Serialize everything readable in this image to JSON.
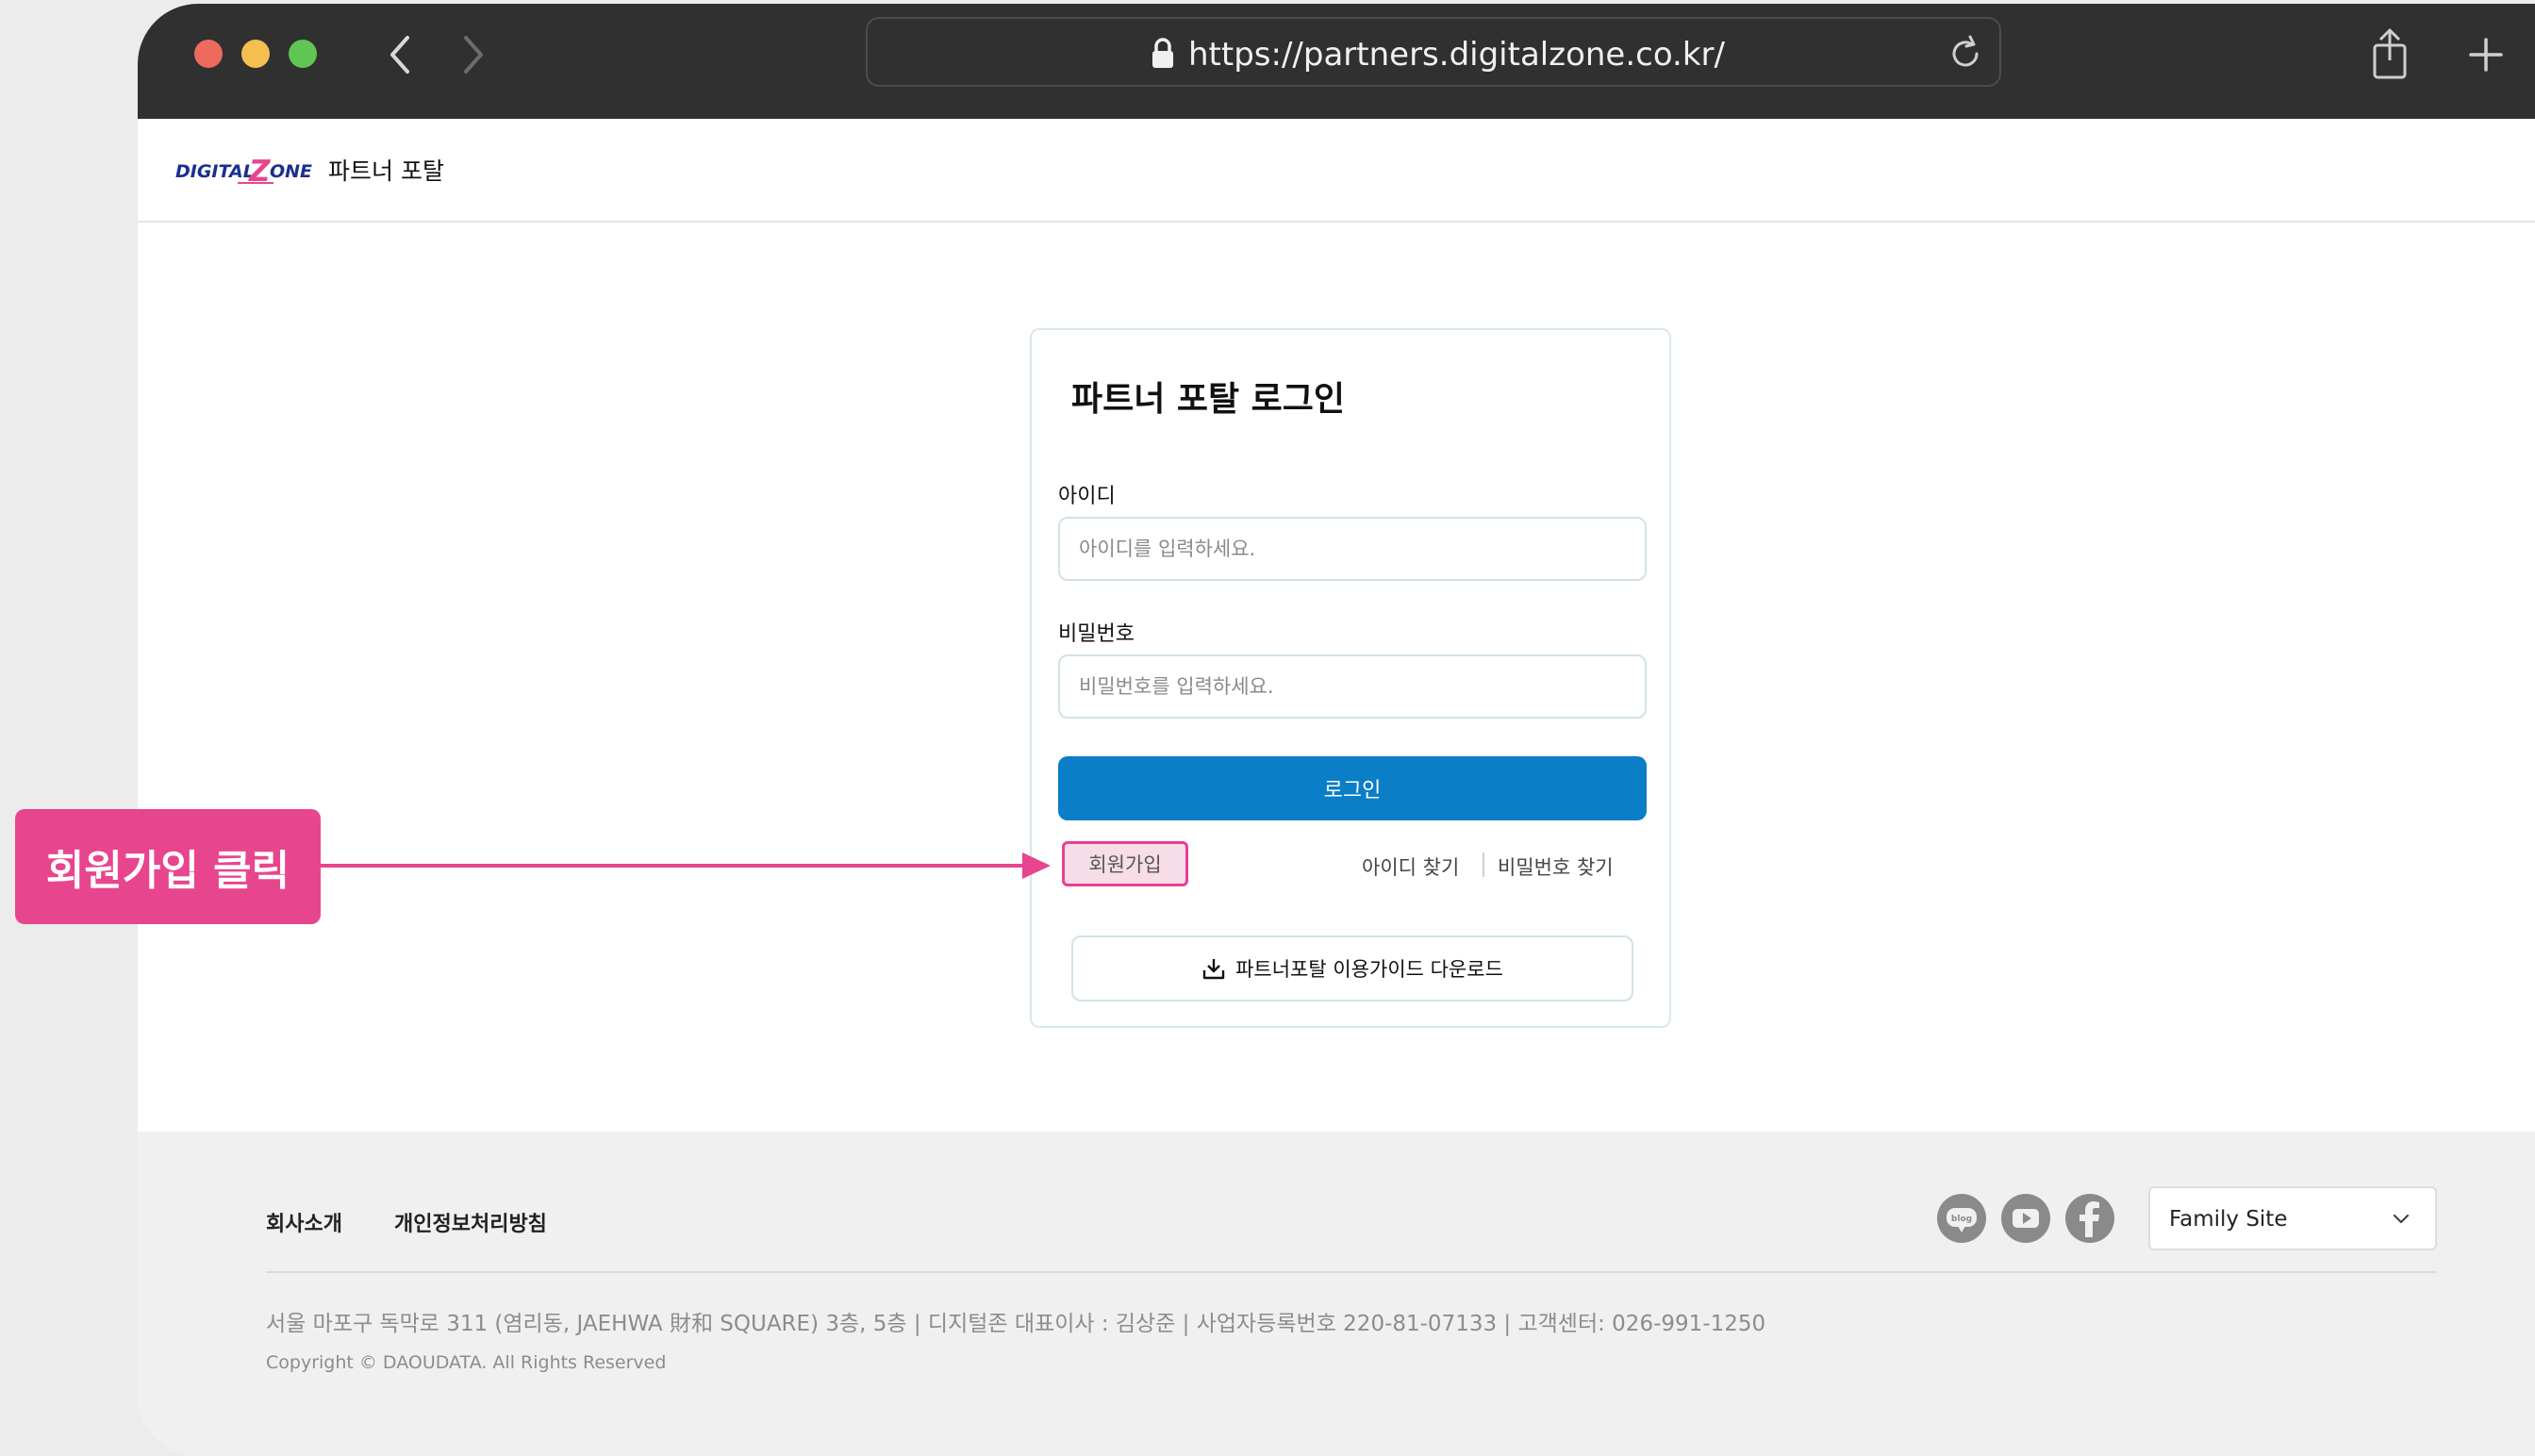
{
  "browser": {
    "url": "https://partners.digitalzone.co.kr/",
    "traffic_lights": {
      "close": "#ed6a5e",
      "minimize": "#f4bf4f",
      "maximize": "#61c554"
    }
  },
  "header": {
    "logo_text": "DIGITALZONE",
    "title": "파트너 포탈"
  },
  "login": {
    "title": "파트너 포탈 로그인",
    "id_label": "아이디",
    "id_placeholder": "아이디를 입력하세요.",
    "password_label": "비밀번호",
    "password_placeholder": "비밀번호를 입력하세요.",
    "login_button": "로그인",
    "signup_button": "회원가입",
    "find_id": "아이디 찾기",
    "find_password": "비밀번호 찾기",
    "guide_button": "파트너포탈 이용가이드 다운로드"
  },
  "annotation": {
    "text": "회원가입 클릭",
    "color": "#e8458f"
  },
  "footer": {
    "links": [
      "회사소개",
      "개인정보처리방침"
    ],
    "social_icons": [
      "blog-icon",
      "youtube-icon",
      "facebook-icon"
    ],
    "family_site": "Family Site",
    "address": "서울 마포구 독막로 311 (염리동, JAEHWA 財和 SQUARE) 3층, 5층  |  디지털존 대표이사 : 김상준  |  사업자등록번호 220-81-07133  |  고객센터: 026-991-1250",
    "copyright": "Copyright © DAOUDATA. All Rights Reserved"
  },
  "colors": {
    "primary": "#0a7ec6",
    "accent": "#e8458f",
    "titlebar": "#303030"
  }
}
